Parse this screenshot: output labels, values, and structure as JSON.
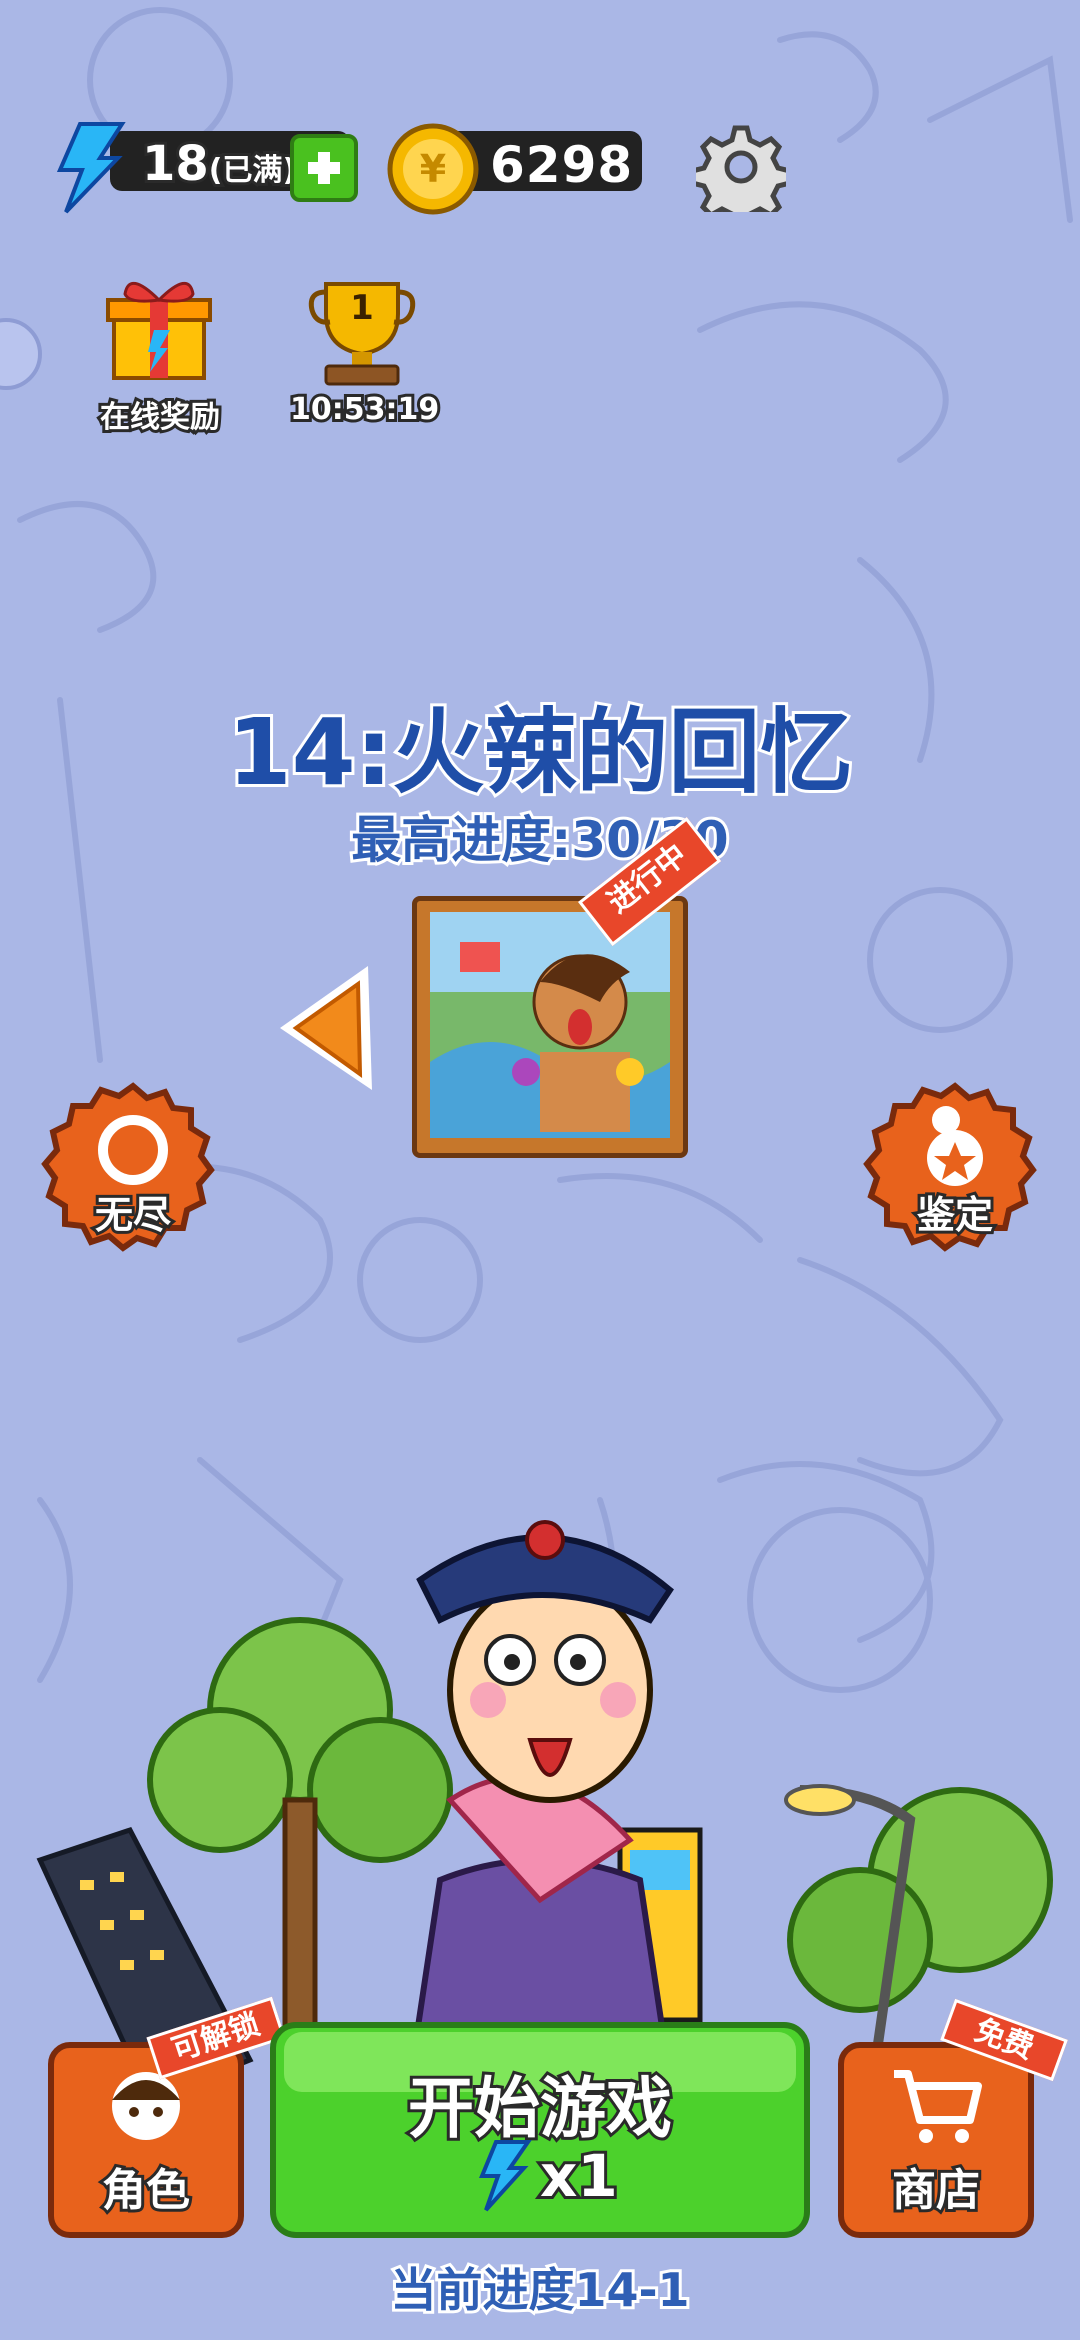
{
  "hud": {
    "energy_value": "18",
    "energy_status": "(已满)",
    "coins": "6298",
    "gear_label": "settings"
  },
  "shortcuts": {
    "online_reward_label": "在线奖励",
    "ranking_rank": "1",
    "ranking_timer": "10:53:19"
  },
  "level": {
    "title": "14:火辣的回忆",
    "best_progress": "最高进度:30/30",
    "status_badge": "进行中"
  },
  "side_buttons": {
    "endless_label": "无尽",
    "appraise_label": "鉴定"
  },
  "bottom": {
    "character_label": "角色",
    "character_ribbon": "可解锁",
    "start_label": "开始游戏",
    "start_cost": "x1",
    "shop_label": "商店",
    "shop_ribbon": "免费",
    "current_progress": "当前进度14-1"
  },
  "colors": {
    "background": "#aab7e6",
    "title_blue": "#1f4ea8",
    "button_green": "#4cd12c",
    "button_orange": "#e8621c",
    "ribbon_red": "#e8472a"
  }
}
